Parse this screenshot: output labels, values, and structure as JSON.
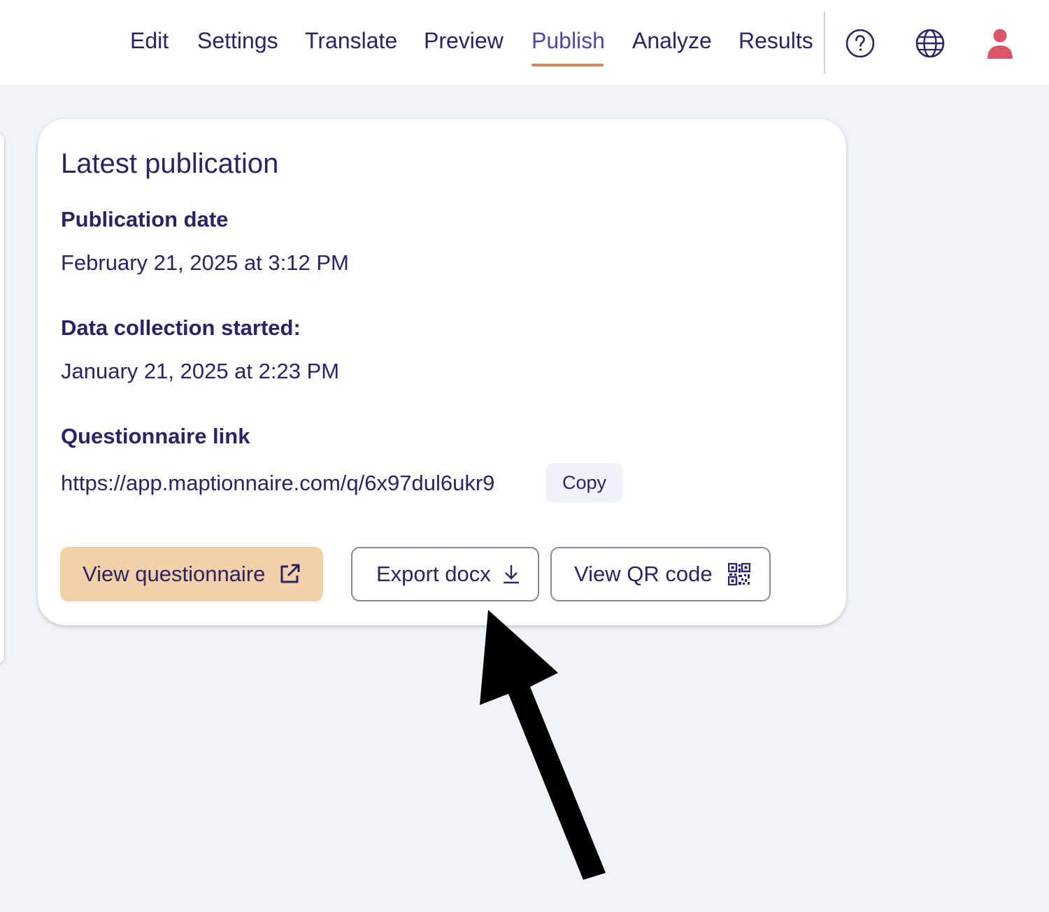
{
  "nav": {
    "items": [
      {
        "label": "Edit"
      },
      {
        "label": "Settings"
      },
      {
        "label": "Translate"
      },
      {
        "label": "Preview"
      },
      {
        "label": "Publish",
        "active": true
      },
      {
        "label": "Analyze"
      },
      {
        "label": "Results"
      }
    ],
    "icons": [
      "help-icon",
      "globe-icon",
      "user-icon"
    ],
    "active_underline_color": "#d9885a",
    "user_icon_color": "#d9566a"
  },
  "card": {
    "title": "Latest publication",
    "publication_date_label": "Publication date",
    "publication_date_value": "February 21, 2025 at 3:12 PM",
    "data_collection_label": "Data collection started:",
    "data_collection_value": "January 21, 2025 at 2:23 PM",
    "link_label": "Questionnaire link",
    "link_value": "https://app.maptionnaire.com/q/6x97dul6ukr9",
    "copy_label": "Copy",
    "buttons": {
      "view_questionnaire": "View questionnaire",
      "export_docx": "Export docx",
      "view_qr": "View QR code"
    }
  },
  "annotation": {
    "type": "arrow",
    "points_to": "export-docx-button",
    "color": "#000000"
  }
}
